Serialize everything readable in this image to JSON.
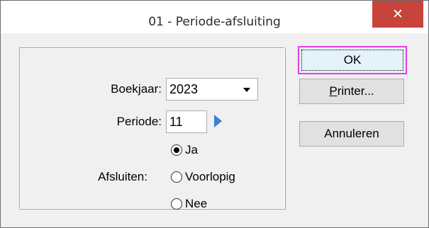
{
  "window": {
    "title": "01 - Periode-afsluiting",
    "close_label": "✕"
  },
  "form": {
    "boekjaar_label": "Boekjaar:",
    "boekjaar_value": "2023",
    "periode_label": "Periode:",
    "periode_value": "11",
    "afsluiten_label": "Afsluiten:",
    "options": [
      {
        "label": "Ja",
        "checked": true
      },
      {
        "label": "Voorlopig",
        "checked": false
      },
      {
        "label": "Nee",
        "checked": false
      }
    ]
  },
  "buttons": {
    "ok": "OK",
    "printer_first": "P",
    "printer_rest": "rinter...",
    "cancel": "Annuleren"
  },
  "colors": {
    "close_bg": "#c8443b",
    "ok_border": "#e040e0",
    "spin_arrow": "#3c7fd1"
  }
}
